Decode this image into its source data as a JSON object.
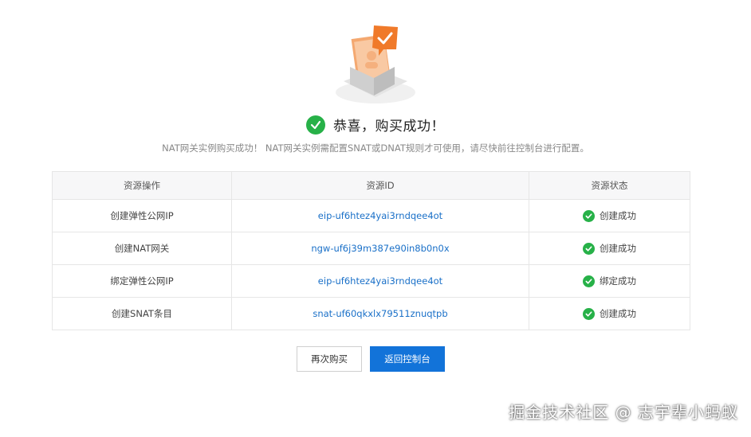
{
  "header": {
    "title": "恭喜，购买成功！",
    "subtitle": "NAT网关实例购买成功！ NAT网关实例需配置SNAT或DNAT规则才可使用，请尽快前往控制台进行配置。"
  },
  "table": {
    "columns": [
      "资源操作",
      "资源ID",
      "资源状态"
    ],
    "rows": [
      {
        "operation": "创建弹性公网IP",
        "id": "eip-uf6htez4yai3rndqee4ot",
        "status": "创建成功"
      },
      {
        "operation": "创建NAT网关",
        "id": "ngw-uf6j39m387e90in8b0n0x",
        "status": "创建成功"
      },
      {
        "operation": "绑定弹性公网IP",
        "id": "eip-uf6htez4yai3rndqee4ot",
        "status": "绑定成功"
      },
      {
        "operation": "创建SNAT条目",
        "id": "snat-uf60qkxlx79511znuqtpb",
        "status": "创建成功"
      }
    ]
  },
  "buttons": {
    "buy_again": "再次购买",
    "back_console": "返回控制台"
  },
  "watermark": "掘金技术社区 @ 志宇辈小蚂蚁",
  "colors": {
    "success": "#27b148",
    "link": "#1a70c8",
    "primary": "#1273d9",
    "illustration_orange": "#f07a2a"
  },
  "icons": {
    "hero": "purchase-success-illustration",
    "title_check": "check-circle-icon",
    "row_check": "check-circle-icon"
  }
}
